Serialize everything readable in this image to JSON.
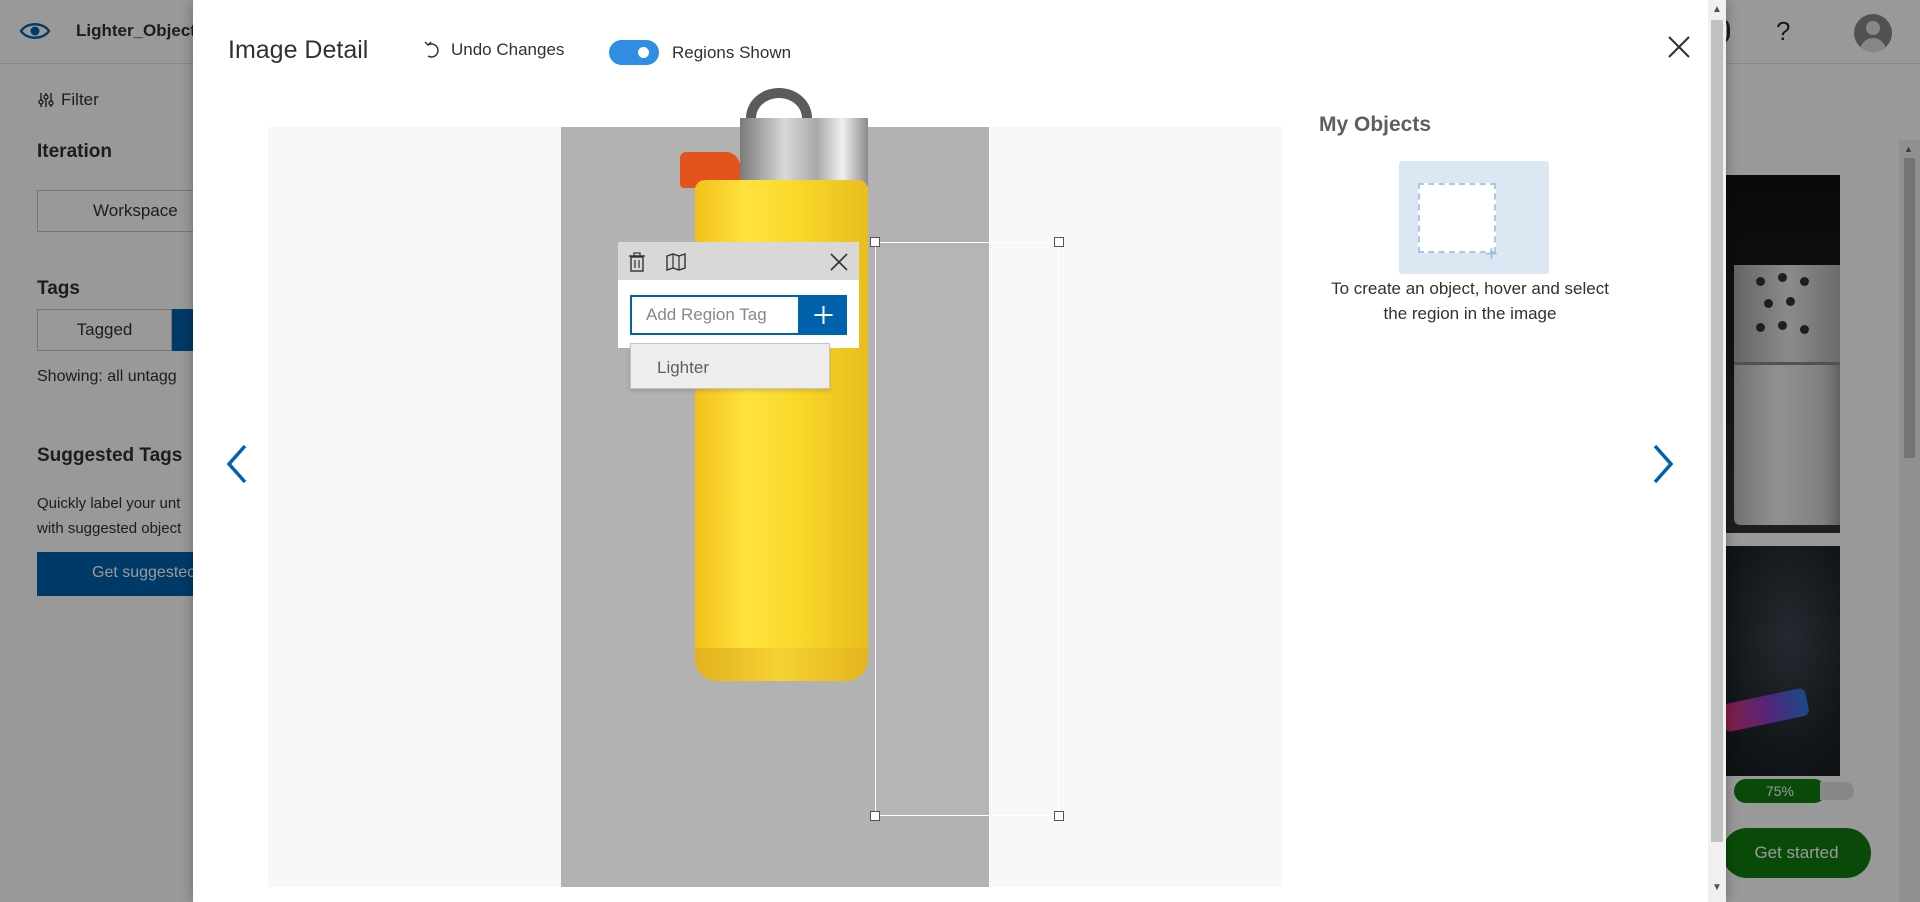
{
  "app": {
    "title": "Lighter_Object",
    "help_label": "?",
    "filter_label": "Filter",
    "iteration_heading": "Iteration",
    "iteration_select": "Workspace",
    "tags_heading": "Tags",
    "tag_tabs": [
      "Tagged",
      ""
    ],
    "showing_text": "Showing: all untagg",
    "suggested_heading": "Suggested Tags",
    "suggested_desc_1": "Quickly label your unt",
    "suggested_desc_2": "with suggested object",
    "suggested_button": "Get suggestec",
    "progress_label": "75%",
    "progress": 0.75,
    "get_started": "Get started"
  },
  "modal": {
    "title": "Image Detail",
    "undo_label": "Undo Changes",
    "toggle_label": "Regions Shown",
    "toggle_on": true,
    "region_editor": {
      "input_placeholder": "Add Region Tag",
      "suggestions": [
        "Lighter"
      ]
    },
    "my_objects": {
      "title": "My Objects",
      "hint": "To create an object, hover and select the region in the image"
    }
  },
  "icons": {
    "logo": "eye-icon",
    "filter": "filter-icon",
    "undo": "undo-icon",
    "close": "close-icon",
    "prev": "chevron-left-icon",
    "next": "chevron-right-icon",
    "delete": "trash-icon",
    "map": "map-icon",
    "add": "plus-icon"
  },
  "colors": {
    "accent": "#0062ad",
    "toggle": "#2f8de4",
    "success": "#107c10"
  }
}
